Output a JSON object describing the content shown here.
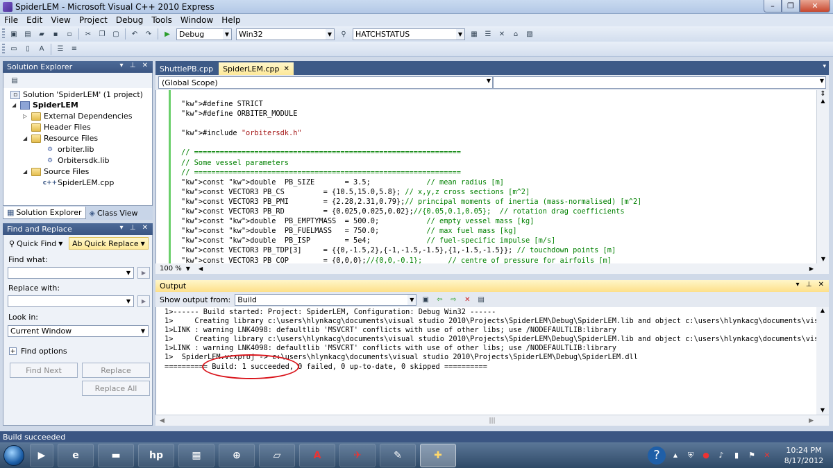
{
  "window": {
    "title": "SpiderLEM - Microsoft Visual C++ 2010 Express"
  },
  "menu": [
    "File",
    "Edit",
    "View",
    "Project",
    "Debug",
    "Tools",
    "Window",
    "Help"
  ],
  "toolbar": {
    "config": "Debug",
    "platform": "Win32",
    "find_combo": "HATCHSTATUS"
  },
  "solution_explorer": {
    "title": "Solution Explorer",
    "tree": [
      {
        "label": "Solution 'SpiderLEM' (1 project)"
      },
      {
        "label": "SpiderLEM"
      },
      {
        "label": "External Dependencies"
      },
      {
        "label": "Header Files"
      },
      {
        "label": "Resource Files"
      },
      {
        "label": "orbiter.lib"
      },
      {
        "label": "Orbitersdk.lib"
      },
      {
        "label": "Source Files"
      },
      {
        "label": "SpiderLEM.cpp"
      }
    ],
    "tabs": [
      "Solution Explorer",
      "Class View"
    ]
  },
  "find_replace": {
    "title": "Find and Replace",
    "modes": [
      "Quick Find",
      "Quick Replace"
    ],
    "find_label": "Find what:",
    "replace_label": "Replace with:",
    "lookin_label": "Look in:",
    "lookin_value": "Current Window",
    "options_label": "Find options",
    "buttons": [
      "Find Next",
      "Replace",
      "Replace All"
    ]
  },
  "editor": {
    "tabs": [
      "ShuttlePB.cpp",
      "SpiderLEM.cpp"
    ],
    "scope": "(Global Scope)",
    "zoom": "100 %",
    "lines": [
      "#define STRICT",
      "#define ORBITER_MODULE",
      "",
      "#include \"orbitersdk.h\"",
      "",
      "// ==============================================================",
      "// Some vessel parameters",
      "// ==============================================================",
      "const double  PB_SIZE       = 3.5;             // mean radius [m]",
      "const VECTOR3 PB_CS         = {10.5,15.0,5.8}; // x,y,z cross sections [m^2]",
      "const VECTOR3 PB_PMI        = {2.28,2.31,0.79};// principal moments of inertia (mass-normalised) [m^2]",
      "const VECTOR3 PB_RD         = {0.025,0.025,0.02};//{0.05,0.1,0.05};  // rotation drag coefficients",
      "const double  PB_EMPTYMASS  = 500.0;           // empty vessel mass [kg]",
      "const double  PB_FUELMASS   = 750.0;           // max fuel mass [kg]",
      "const double  PB_ISP        = 5e4;             // fuel-specific impulse [m/s]",
      "const VECTOR3 PB_TDP[3]     = {{0,-1.5,2},{-1,-1.5,-1.5},{1,-1.5,-1.5}}; // touchdown points [m]",
      "const VECTOR3 PB_COP        = {0,0,0};//{0,0,-0.1};      // centre of pressure for airfoils [m]"
    ]
  },
  "output": {
    "title": "Output",
    "show_from_label": "Show output from:",
    "show_from_value": "Build",
    "lines": [
      "1>------ Build started: Project: SpiderLEM, Configuration: Debug Win32 ------",
      "1>     Creating library c:\\users\\hlynkacg\\documents\\visual studio 2010\\Projects\\SpiderLEM\\Debug\\SpiderLEM.lib and object c:\\users\\hlynkacg\\documents\\visu",
      "1>LINK : warning LNK4098: defaultlib 'MSVCRT' conflicts with use of other libs; use /NODEFAULTLIB:library",
      "1>     Creating library c:\\users\\hlynkacg\\documents\\visual studio 2010\\Projects\\SpiderLEM\\Debug\\SpiderLEM.lib and object c:\\users\\hlynkacg\\documents\\visu",
      "1>LINK : warning LNK4098: defaultlib 'MSVCRT' conflicts with use of other libs; use /NODEFAULTLIB:library",
      "1>  SpiderLEM.vcxproj -> c:\\users\\hlynkacg\\documents\\visual studio 2010\\Projects\\SpiderLEM\\Debug\\SpiderLEM.dll",
      "========== Build: 1 succeeded, 0 failed, 0 up-to-date, 0 skipped =========="
    ]
  },
  "status": {
    "text": "Build succeeded"
  },
  "taskbar": {
    "time": "10:24 PM",
    "date": "8/17/2012"
  },
  "colors": {
    "accent": "#3b5683",
    "annotation": "#d9141b"
  }
}
